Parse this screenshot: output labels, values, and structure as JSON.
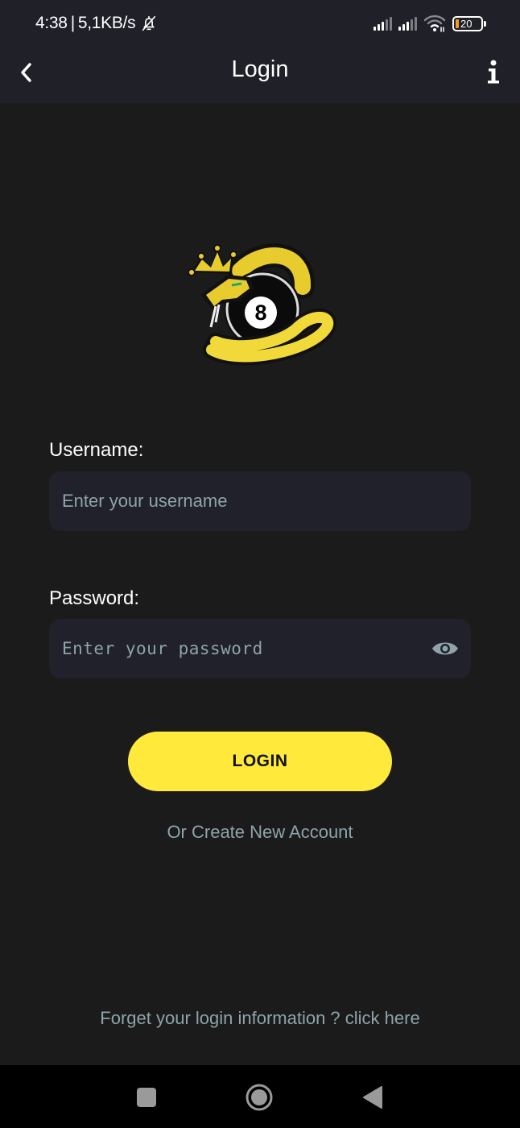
{
  "status_bar": {
    "time": "4:38",
    "separator": "|",
    "network_speed": "5,1KB/s",
    "battery_level": "20",
    "icons": [
      "mute-bell-icon",
      "signal-icon",
      "signal-icon",
      "wifi-icon",
      "battery-icon"
    ]
  },
  "app_bar": {
    "title": "Login",
    "back_icon": "chevron-left-icon",
    "info_icon": "info-icon"
  },
  "logo": {
    "icon": "snake-8-ball-crown-logo",
    "ball_number": "8"
  },
  "form": {
    "username": {
      "label": "Username:",
      "value": "",
      "placeholder": "Enter your username"
    },
    "password": {
      "label": "Password:",
      "value": "",
      "placeholder": "Enter your password",
      "toggle_icon": "eye-icon"
    },
    "login_label": "LOGIN",
    "create_account_label": "Or Create New Account",
    "forgot_label": "Forget your login information ? click here"
  },
  "colors": {
    "accent": "#ffe93a",
    "background": "#1b1b1c",
    "bar_background": "#1f2028",
    "input_background": "#20212b",
    "muted_text": "#8ea3aa"
  },
  "nav_bar": {
    "buttons": [
      "recents-icon",
      "home-icon",
      "back-icon"
    ]
  }
}
